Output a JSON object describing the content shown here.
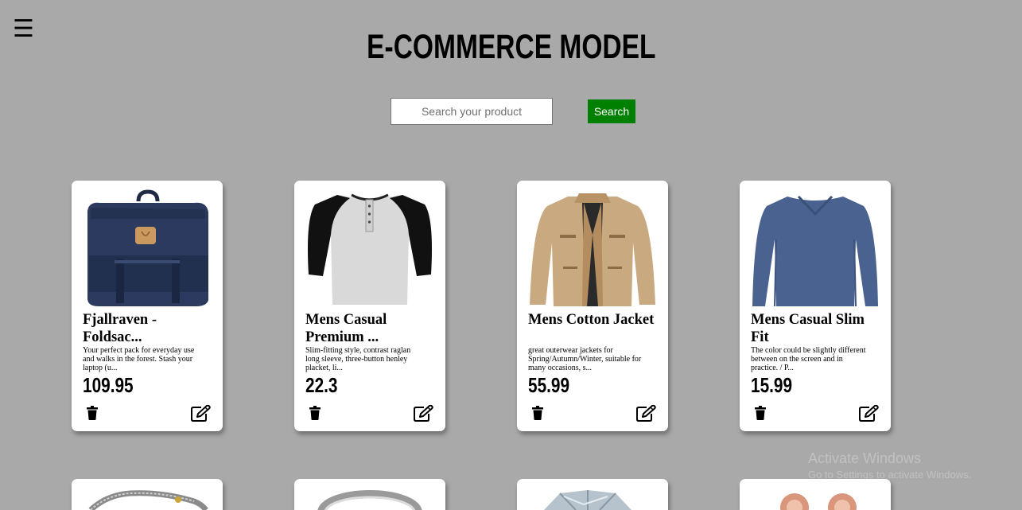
{
  "header": {
    "menu_icon": "hamburger-menu-icon",
    "title": "E-COMMERCE MODEL"
  },
  "search": {
    "placeholder": "Search your product",
    "value": "",
    "button_label": "Search",
    "button_color": "#008000"
  },
  "colors": {
    "background": "#a9a9a9",
    "card": "#ffffff"
  },
  "products": [
    {
      "title": "Fjallraven - Foldsac...",
      "description": "Your perfect pack for everyday use and walks in the forest. Stash your laptop (u...",
      "price": "109.95",
      "image_icon": "backpack-icon"
    },
    {
      "title": "Mens Casual Premium ...",
      "description": "Slim-fitting style, contrast raglan long sleeve, three-button henley placket, li...",
      "price": "22.3",
      "image_icon": "raglan-shirt-icon"
    },
    {
      "title": "Mens Cotton Jacket",
      "description": "great outerwear jackets for Spring/Autumn/Winter, suitable for many occasions, s...",
      "price": "55.99",
      "image_icon": "jacket-icon"
    },
    {
      "title": "Mens Casual Slim Fit",
      "description": "The color could be slightly different between on the screen and in practice. / P...",
      "price": "15.99",
      "image_icon": "long-sleeve-shirt-icon"
    }
  ],
  "products_row2_icons": [
    "bracelet-icon",
    "ring-icon",
    "diamond-ring-icon",
    "earrings-icon"
  ],
  "actions": {
    "delete_icon": "trash-icon",
    "edit_icon": "edit-icon"
  },
  "watermark": {
    "title": "Activate Windows",
    "subtitle": "Go to Settings to activate Windows."
  }
}
